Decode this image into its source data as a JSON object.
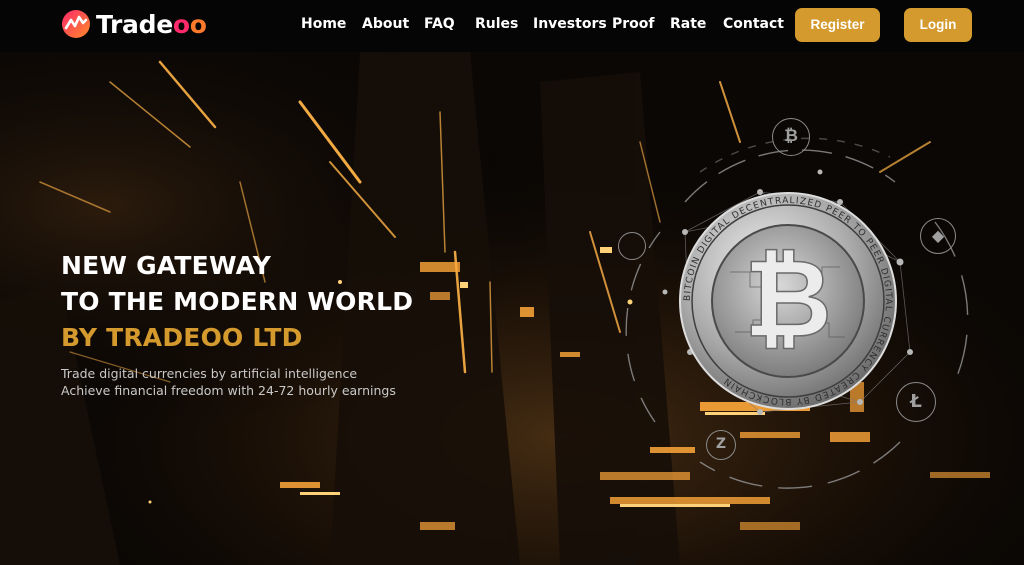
{
  "brand": {
    "name": "Tradeoo",
    "accent": "#d49a2e",
    "logo_colors": [
      "#ff2a6a",
      "#ff7a2a"
    ]
  },
  "nav": {
    "links": [
      "Home",
      "About",
      "FAQ",
      "Rules",
      "Investors",
      "Proof",
      "Rate",
      "Contact"
    ],
    "register_label": "Register",
    "login_label": "Login"
  },
  "hero": {
    "heading_line1": "NEW GATEWAY",
    "heading_line2": "TO THE MODERN WORLD",
    "heading_line3": "BY TRADEOO LTD",
    "sub_line1": "Trade digital currencies by artificial intelligence",
    "sub_line2": "Achieve financial freedom with 24-72 hourly earnings",
    "coin_ring_text": "BITCOIN DIGITAL DECENTRALIZED PEER TO PEER DIGITAL CURRENCY CREATED BY BLOCKCHAIN",
    "coin_icons": [
      "bitcoin-icon",
      "ethereum-icon",
      "litecoin-icon",
      "zcash-icon"
    ]
  }
}
